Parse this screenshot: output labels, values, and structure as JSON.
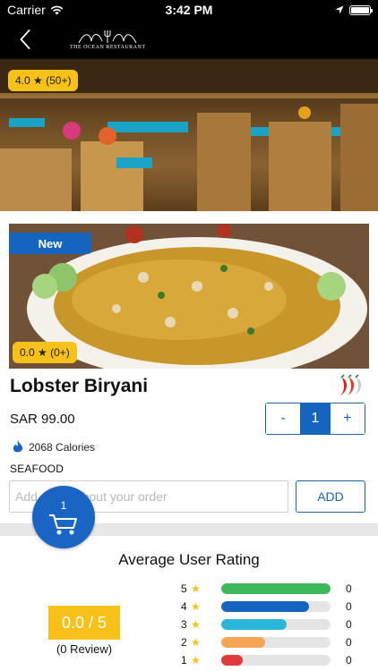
{
  "status_bar": {
    "carrier": "Carrier",
    "time": "3:42 PM"
  },
  "nav": {
    "logo_text": "THE OCEAN RESTAURANT"
  },
  "hero": {
    "rating": "4.0 ★ (50+)"
  },
  "dish": {
    "badge": "New",
    "rating": "0.0 ★ (0+)",
    "name": "Lobster Biryani",
    "price": "SAR 99.00",
    "quantity": "1",
    "qty_minus": "-",
    "qty_plus": "+",
    "calories": "2068 Calories",
    "category": "SEAFOOD",
    "note_placeholder": "Add notes about your order",
    "add_label": "ADD",
    "spice_icon": "chili-pepper-icon"
  },
  "cart": {
    "count": "1",
    "icon": "cart-icon"
  },
  "ratings": {
    "title": "Average User Rating",
    "average": "0.0 / 5",
    "reviews": "(0 Review)",
    "bars": [
      {
        "label": "5",
        "count": "0",
        "fill": 1.0,
        "color": "#3cb85a"
      },
      {
        "label": "4",
        "count": "0",
        "fill": 0.8,
        "color": "#1565c0"
      },
      {
        "label": "3",
        "count": "0",
        "fill": 0.6,
        "color": "#29b6d8"
      },
      {
        "label": "2",
        "count": "0",
        "fill": 0.4,
        "color": "#f5a655"
      },
      {
        "label": "1",
        "count": "0",
        "fill": 0.2,
        "color": "#e03a3a"
      }
    ]
  },
  "colors": {
    "accent": "#1565c0",
    "rating_badge": "#f6c21a"
  }
}
